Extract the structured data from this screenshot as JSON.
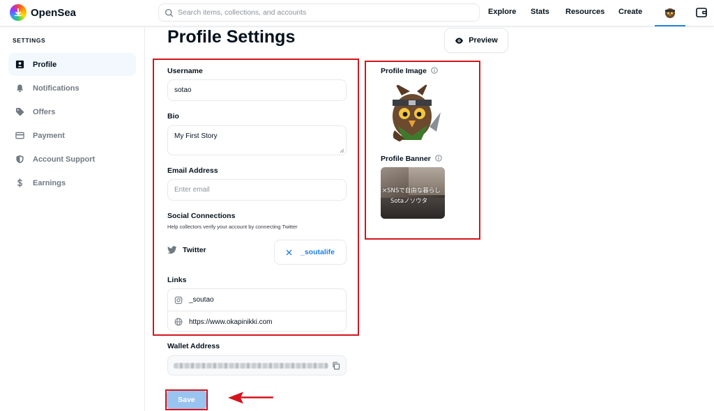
{
  "header": {
    "brand": "OpenSea",
    "search_placeholder": "Search items, collections, and accounts",
    "nav": [
      "Explore",
      "Stats",
      "Resources",
      "Create"
    ]
  },
  "sidebar": {
    "title": "SETTINGS",
    "items": [
      {
        "label": "Profile",
        "icon": "profile-card-icon",
        "active": true
      },
      {
        "label": "Notifications",
        "icon": "bell-icon"
      },
      {
        "label": "Offers",
        "icon": "tag-icon"
      },
      {
        "label": "Payment",
        "icon": "credit-card-icon"
      },
      {
        "label": "Account Support",
        "icon": "shield-icon"
      },
      {
        "label": "Earnings",
        "icon": "dollar-icon"
      }
    ]
  },
  "main": {
    "title": "Profile Settings",
    "preview_label": "Preview",
    "username_label": "Username",
    "username_value": "sotao",
    "bio_label": "Bio",
    "bio_value": "My First Story",
    "email_label": "Email Address",
    "email_placeholder": "Enter email",
    "social_label": "Social Connections",
    "social_hint": "Help collectors verify your account by connecting Twitter",
    "twitter_label": "Twitter",
    "twitter_handle": "_soutalife",
    "links_label": "Links",
    "links": [
      {
        "icon": "instagram-icon",
        "value": "_soutao"
      },
      {
        "icon": "globe-icon",
        "value": "https://www.okapinikki.com"
      }
    ],
    "wallet_label": "Wallet Address",
    "save_label": "Save"
  },
  "right": {
    "profile_image_label": "Profile Image",
    "profile_banner_label": "Profile Banner",
    "banner_text_line1": "×SNSで自由な暮らし",
    "banner_text_line2": "Sotaノソウタ"
  },
  "colors": {
    "accent": "#2081e2",
    "annotation_red": "#d4141c",
    "save_button": "#9ac4f0",
    "active_bg": "#f2f8fd"
  }
}
